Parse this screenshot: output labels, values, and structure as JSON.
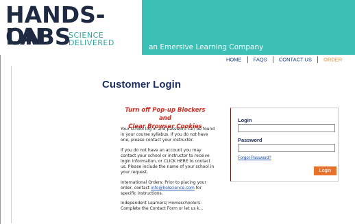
{
  "header": {
    "logo_line1": "HANDS-ON",
    "logo_line2": "LABS",
    "logo_sub1": "SCIENCE",
    "logo_sub2": "DELIVERED",
    "tagline": "an Emersive Learning Company",
    "brand_teal": "#3cbfb4",
    "brand_navy": "#1e2a42"
  },
  "nav": {
    "items": [
      "HOME",
      "FAQS",
      "CONTACT US",
      "ORDER"
    ]
  },
  "page": {
    "title": "Customer Login"
  },
  "notice": {
    "line1": "Turn off Pop-up Blockers and",
    "line2": "Clear Browser Cookies"
  },
  "info": {
    "p1": "Your school log in and password can be found in your course syllabus. If you do not have one, please contact your instructor.",
    "p2": "If you do not have an account you may contact your school or instructor to receive login information, or CLICK HERE to contact us. Please include the name of your school in your request.",
    "p3_prefix": "International Orders: Prior to placing your order, contact ",
    "p3_email": "info@holscience.com",
    "p3_suffix": " for specific instructions.",
    "p4": "Independent Learners/ Homeschoolers: Complete the Contact Form or let us k..."
  },
  "login": {
    "login_label": "Login",
    "login_value": "",
    "password_label": "Password",
    "password_value": "",
    "forgot_label": "Forgot Password?",
    "button_label": "Login",
    "button_color": "#e8722b"
  }
}
